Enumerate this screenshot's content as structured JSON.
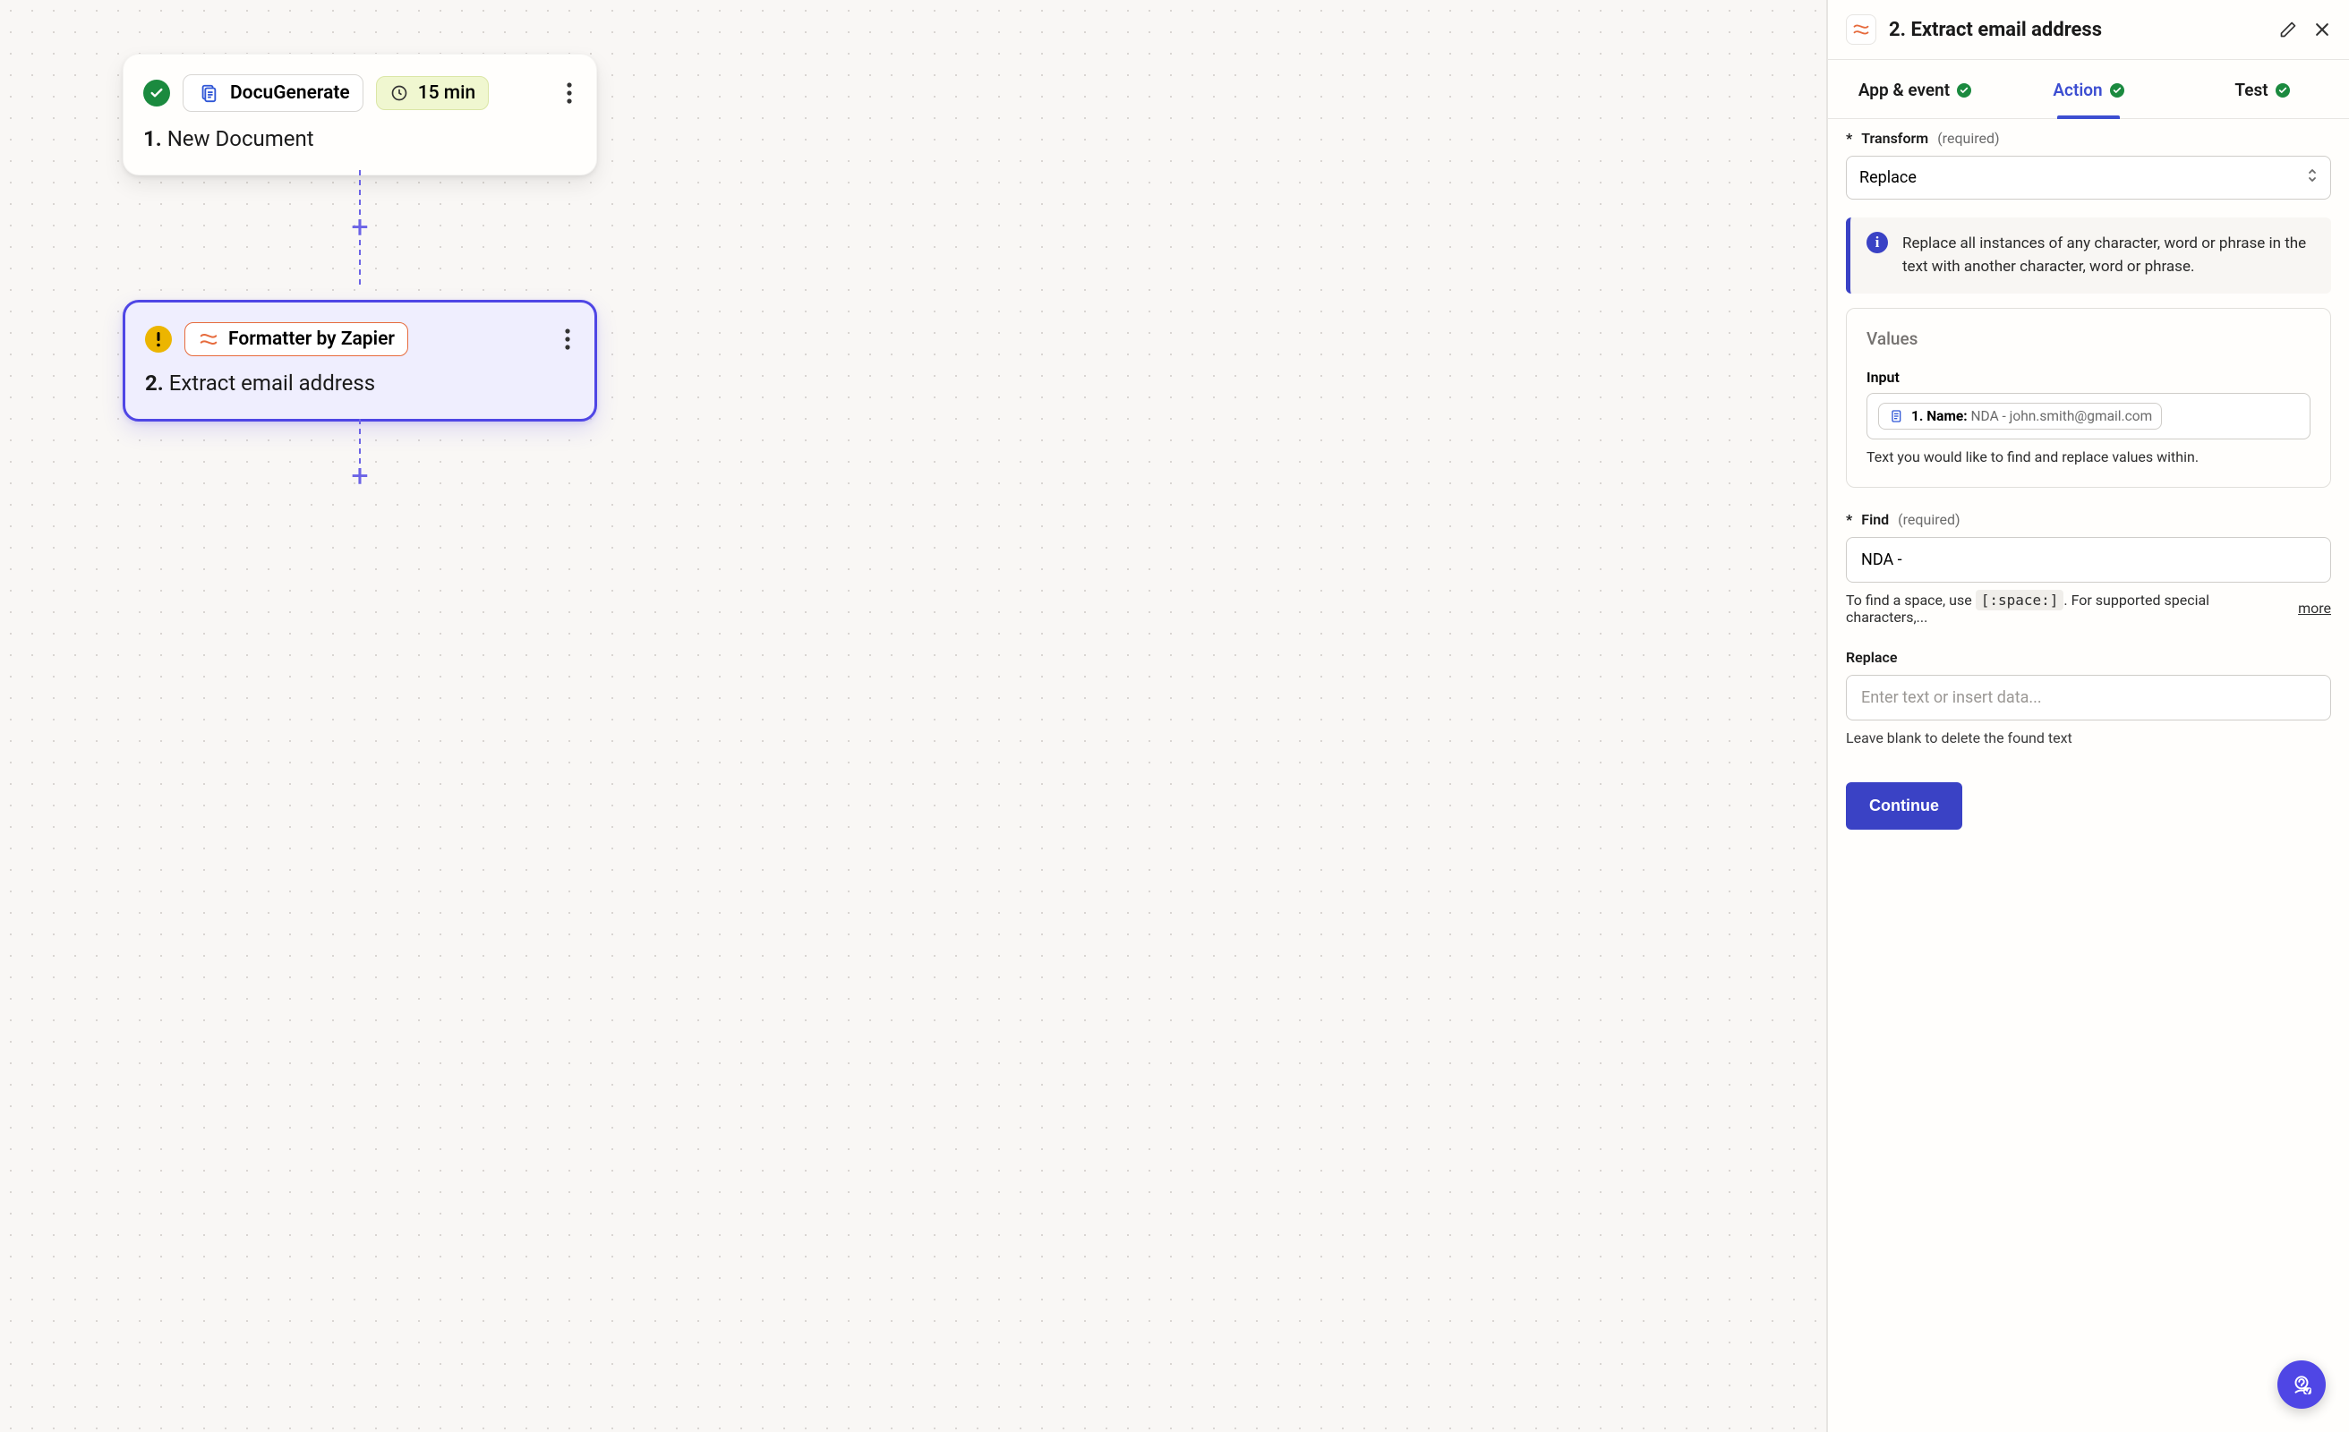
{
  "canvas": {
    "node1": {
      "app": "DocuGenerate",
      "timer": "15 min",
      "step_num": "1.",
      "step_title": "New Document"
    },
    "node2": {
      "app": "Formatter by Zapier",
      "step_num": "2.",
      "step_title": "Extract email address"
    }
  },
  "panel": {
    "title": "2. Extract email address",
    "tabs": {
      "app": "App & event",
      "action": "Action",
      "test": "Test"
    },
    "transform": {
      "label": "Transform",
      "required": "(required)",
      "value": "Replace"
    },
    "info_text": "Replace all instances of any character, word or phrase in the text with another character, word or phrase.",
    "values": {
      "section_title": "Values",
      "input_label": "Input",
      "pill_label": "1. Name:",
      "pill_value": "NDA - john.smith@gmail.com",
      "input_help": "Text you would like to find and replace values within."
    },
    "find": {
      "label": "Find",
      "required": "(required)",
      "value": "NDA - ",
      "help_prefix": "To find a space, use ",
      "help_code": "[:space:]",
      "help_suffix": ". For supported special characters,...",
      "more": "more"
    },
    "replace": {
      "label": "Replace",
      "placeholder": "Enter text or insert data...",
      "help": "Leave blank to delete the found text"
    },
    "continue": "Continue"
  }
}
